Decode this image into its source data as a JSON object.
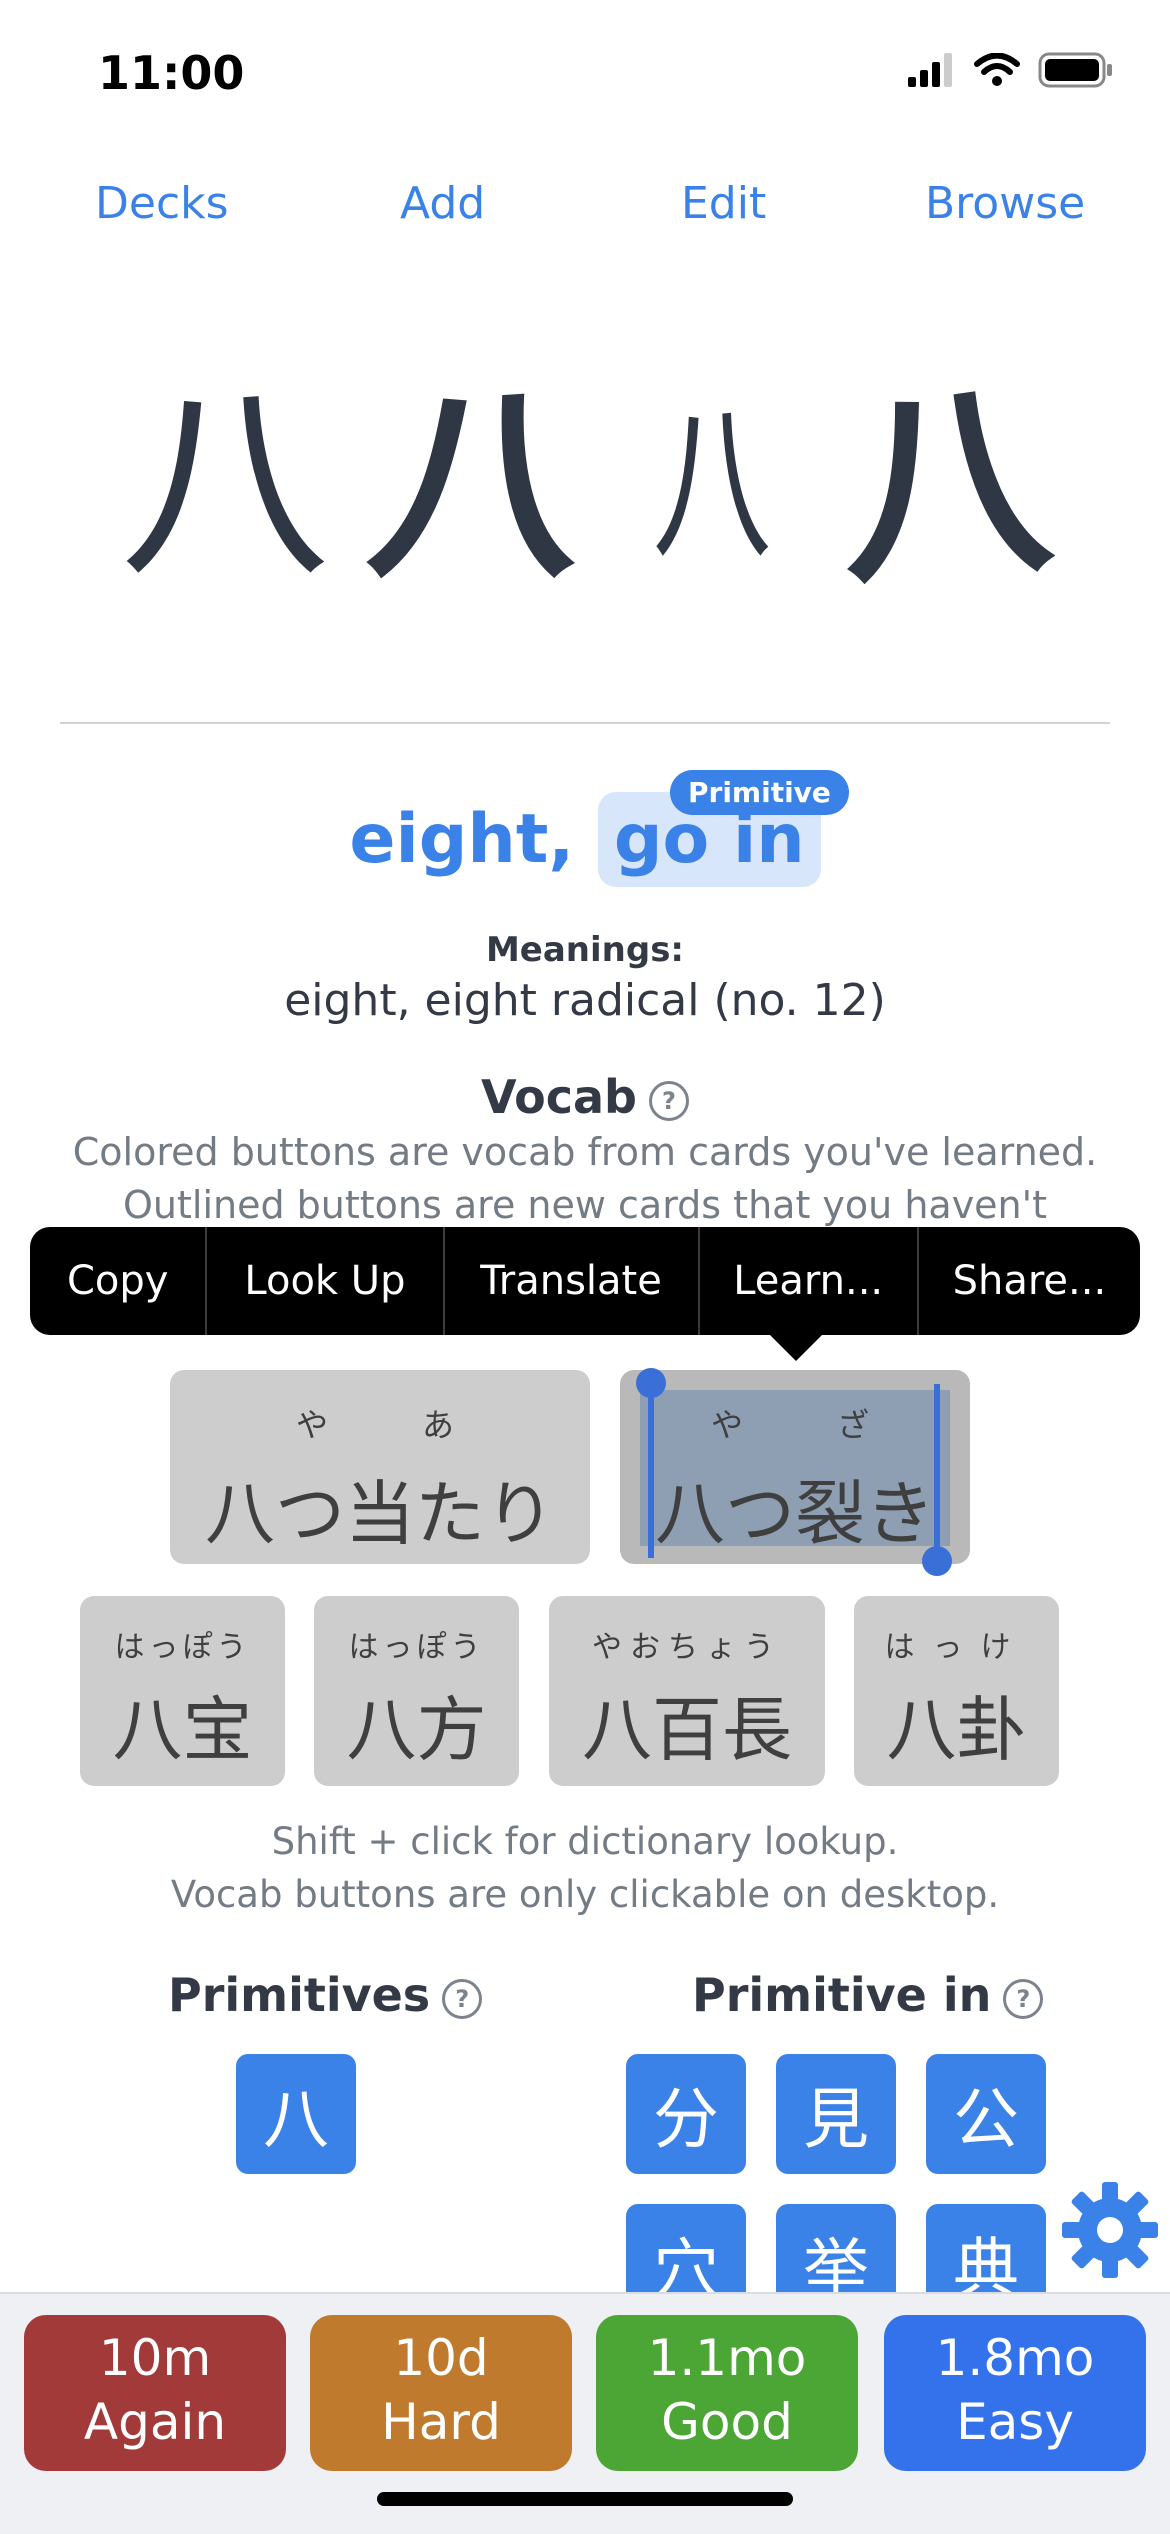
{
  "status": {
    "time": "11:00"
  },
  "nav": [
    "Decks",
    "Add",
    "Edit",
    "Browse"
  ],
  "kanji_variants": [
    "八",
    "八",
    "八",
    "八"
  ],
  "keyword": {
    "part1": "eight,",
    "part2": "go in",
    "badge": "Primitive"
  },
  "meanings": {
    "title": "Meanings:",
    "text": "eight, eight radical (no. 12)"
  },
  "vocab": {
    "title": "Vocab",
    "desc_line1": "Colored buttons are vocab from cards you've learned.",
    "desc_line2": "Outlined buttons are new cards that you haven't",
    "buttons": [
      {
        "furigana": "や　　あ",
        "word": "八つ当たり"
      },
      {
        "furigana": "や　　ざ",
        "word": "八つ裂き"
      },
      {
        "furigana": "はっぽう",
        "word": "八宝"
      },
      {
        "furigana": "はっぽう",
        "word": "八方"
      },
      {
        "furigana": "やおちょう",
        "word": "八百長"
      },
      {
        "furigana": "はっけ",
        "word": "八卦"
      }
    ]
  },
  "context_menu": [
    "Copy",
    "Look Up",
    "Translate",
    "Learn...",
    "Share..."
  ],
  "hint": {
    "line1": "Shift + click for dictionary lookup.",
    "line2": "Vocab buttons are only clickable on desktop."
  },
  "primitives": {
    "title": "Primitives",
    "items": [
      "八"
    ]
  },
  "primitive_in": {
    "title": "Primitive in",
    "items": [
      "分",
      "見",
      "公",
      "穴",
      "挙",
      "典"
    ]
  },
  "answers": [
    {
      "interval": "10m",
      "label": "Again",
      "color": "#a33a3a"
    },
    {
      "interval": "10d",
      "label": "Hard",
      "color": "#c07a2e"
    },
    {
      "interval": "1.1mo",
      "label": "Good",
      "color": "#4ba636"
    },
    {
      "interval": "1.8mo",
      "label": "Easy",
      "color": "#3372ea"
    }
  ],
  "colors": {
    "accent": "#3a82e8",
    "text": "#333a46",
    "muted": "#737b85"
  }
}
